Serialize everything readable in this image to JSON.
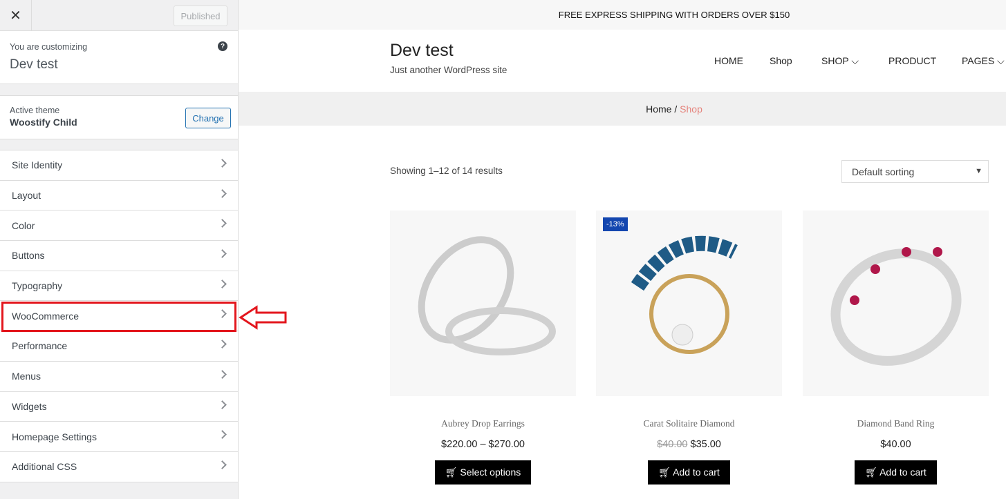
{
  "sidebar": {
    "close": "✕",
    "published": "Published",
    "customizing_label": "You are customizing",
    "site_name": "Dev test",
    "help": "?",
    "active_theme_label": "Active theme",
    "theme_name": "Woostify Child",
    "change": "Change",
    "items": [
      {
        "label": "Site Identity"
      },
      {
        "label": "Layout"
      },
      {
        "label": "Color"
      },
      {
        "label": "Buttons"
      },
      {
        "label": "Typography"
      },
      {
        "label": "WooCommerce"
      },
      {
        "label": "Performance"
      },
      {
        "label": "Menus"
      },
      {
        "label": "Widgets"
      },
      {
        "label": "Homepage Settings"
      },
      {
        "label": "Additional CSS"
      }
    ],
    "highlight_color": "#e3161d"
  },
  "preview": {
    "shipping": "FREE EXPRESS SHIPPING WITH ORDERS OVER $150",
    "site_title": "Dev test",
    "tagline": "Just another WordPress site",
    "nav": [
      {
        "label": "HOME"
      },
      {
        "label": "Shop"
      },
      {
        "label": "SHOP"
      },
      {
        "label": "PRODUCT"
      },
      {
        "label": "PAGES"
      }
    ],
    "breadcrumb": {
      "home": "Home",
      "sep": "/",
      "current": "Shop"
    },
    "result_count": "Showing 1–12 of 14 results",
    "sorting": "Default sorting",
    "products": [
      {
        "name": "Aubrey Drop Earrings",
        "price": "$220.00 – $270.00",
        "old_price": "",
        "button": "Select options",
        "badge": ""
      },
      {
        "name": "Carat Solitaire Diamond",
        "price": "$35.00",
        "old_price": "$40.00",
        "button": "Add to cart",
        "badge": "-13%"
      },
      {
        "name": "Diamond Band Ring",
        "price": "$40.00",
        "old_price": "",
        "button": "Add to cart",
        "badge": ""
      }
    ]
  }
}
